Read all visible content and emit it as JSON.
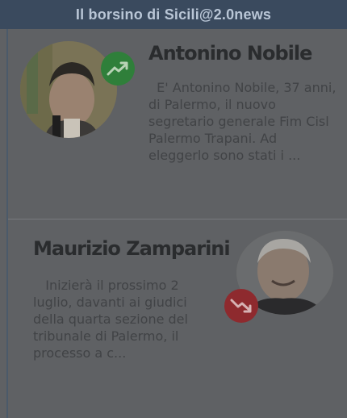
{
  "header": {
    "title": "Il borsino di Sicili@2.0news"
  },
  "items": [
    {
      "name": "Antonino Nobile",
      "trend": "up",
      "trend_icon": "trend-up-icon",
      "excerpt": "  E' Antonino Nobile, 37 anni,\ndi Palermo, il nuovo\nsegretario generale Fim Cisl\nPalermo Trapani. Ad\neleggerlo sono stati i ..."
    },
    {
      "name": "Maurizio Zamparini",
      "trend": "down",
      "trend_icon": "trend-down-icon",
      "excerpt": "   Inizierà il prossimo 2\nluglio, davanti ai giudici\ndella quarta sezione del\ntribunale di Palermo, il\nprocesso a c..."
    }
  ],
  "colors": {
    "header_bg": "#3a4a5e",
    "trend_up": "#2f7f3a",
    "trend_down": "#8e2a2e"
  }
}
